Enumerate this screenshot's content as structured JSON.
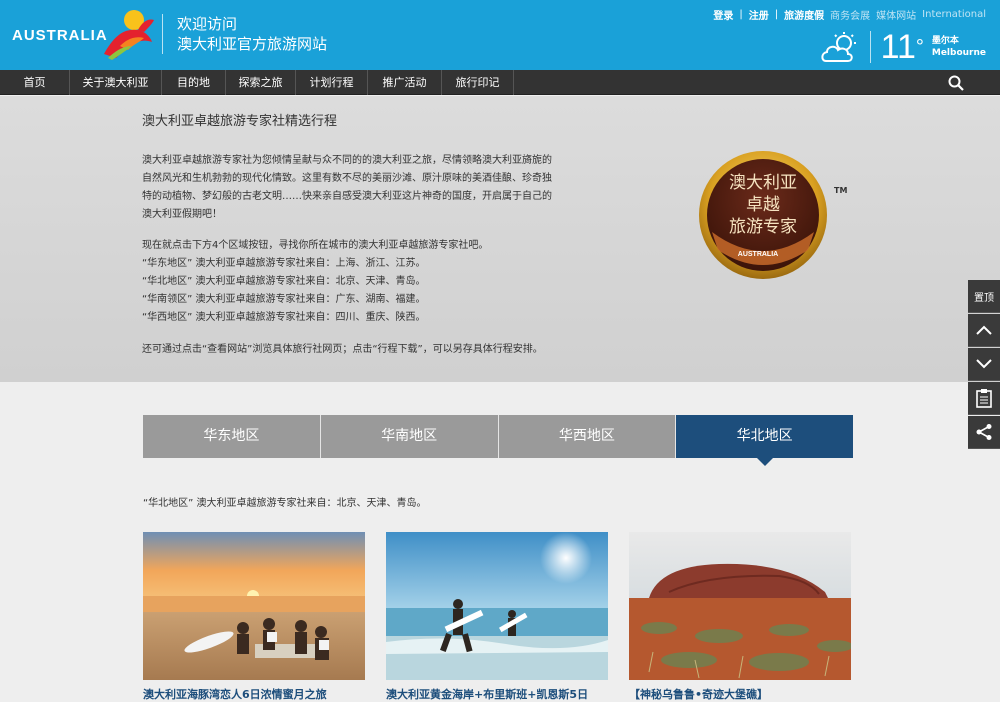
{
  "header": {
    "logo_text": "AUSTRALIA",
    "welcome_line1": "欢迎访问",
    "welcome_line2": "澳大利亚官方旅游网站",
    "links": {
      "login": "登录",
      "sep": "|",
      "register": "注册",
      "holiday": "旅游度假",
      "business": "商务会展",
      "media": "媒体网站",
      "international": "International"
    },
    "weather": {
      "temperature": "11",
      "degree": "°",
      "city_cn": "墨尔本",
      "city_en": "Melbourne",
      "icon": "partly-cloudy-icon"
    }
  },
  "nav": {
    "items": [
      "首页",
      "关于澳大利亚",
      "目的地",
      "探索之旅",
      "计划行程",
      "推广活动",
      "旅行印记"
    ],
    "search_icon": "search-icon"
  },
  "intro": {
    "title": "澳大利亚卓越旅游专家社精选行程",
    "p1_lines": [
      "澳大利亚卓越旅游专家社为您倾情呈献与众不同的的澳大利亚之旅，尽情领略澳大利亚旖旎的",
      "自然风光和生机勃勃的现代化情致。这里有数不尽的美丽沙滩、原汁原味的美酒佳酿、珍奇独",
      "特的动植物、梦幻般的古老文明……快来亲自感受澳大利亚这片神奇的国度，开启属于自己的",
      "澳大利亚假期吧！"
    ],
    "p2_lines": [
      "现在就点击下方4个区域按钮，寻找你所在城市的澳大利亚卓越旅游专家社吧。",
      "“华东地区” 澳大利亚卓越旅游专家社来自：上海、浙江、江苏。",
      "“华北地区” 澳大利亚卓越旅游专家社来自：北京、天津、青岛。",
      "“华南领区” 澳大利亚卓越旅游专家社来自：广东、湖南、福建。",
      "“华西地区” 澳大利亚卓越旅游专家社来自：四川、重庆、陕西。"
    ],
    "p3": "还可通过点击“查看网站”浏览具体旅行社网页；点击“行程下载”，可以另存具体行程安排。",
    "badge": {
      "line1": "澳大利亚",
      "line2": "卓越",
      "line3": "旅游专家",
      "brand": "AUSTRALIA",
      "tm": "TM"
    }
  },
  "tabs": [
    {
      "label": "华东地区",
      "active": false
    },
    {
      "label": "华南地区",
      "active": false
    },
    {
      "label": "华西地区",
      "active": false
    },
    {
      "label": "华北地区",
      "active": true
    }
  ],
  "region_text": "“华北地区” 澳大利亚卓越旅游专家社来自：北京、天津、青岛。",
  "cards": [
    {
      "title": "澳大利亚海豚湾恋人6日浓情蜜月之旅"
    },
    {
      "title": "澳大利亚黄金海岸+布里斯班+凯恩斯5日"
    },
    {
      "title": "【神秘乌鲁鲁•奇迹大堡礁】"
    }
  ],
  "side": {
    "top_label": "置顶",
    "up_icon": "chevron-up-icon",
    "down_icon": "chevron-down-icon",
    "clipboard_icon": "clipboard-icon",
    "share_icon": "share-icon"
  },
  "colors": {
    "header_blue": "#1aa1d8",
    "nav_dark": "#333333",
    "tab_active": "#1d4e7c",
    "tab_inactive": "#9a9a9a"
  }
}
